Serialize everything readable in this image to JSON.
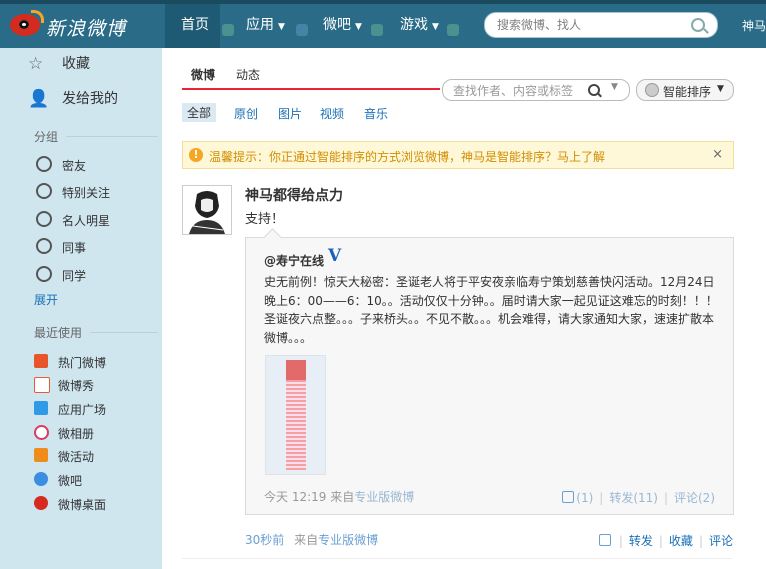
{
  "topbar": {
    "logo_text": "新浪微博",
    "nav": [
      {
        "label": "首页"
      },
      {
        "label": "应用"
      },
      {
        "label": "微吧"
      },
      {
        "label": "游戏"
      }
    ],
    "search_placeholder": "搜索微博、找人",
    "username": "神马"
  },
  "sidebar": {
    "favorites": "收藏",
    "sent_to_me": "发给我的",
    "groups_heading": "分组",
    "groups": [
      "密友",
      "特别关注",
      "名人明星",
      "同事",
      "同学"
    ],
    "expand": "展开",
    "recent_heading": "最近使用",
    "apps": [
      {
        "label": "热门微博",
        "icon": "hot-icon",
        "color": "#e8542b"
      },
      {
        "label": "微博秀",
        "icon": "show-icon",
        "color": "#e45b3a"
      },
      {
        "label": "应用广场",
        "icon": "app-square-icon",
        "color": "#2f9be8"
      },
      {
        "label": "微相册",
        "icon": "album-icon",
        "color": "#d93d62"
      },
      {
        "label": "微活动",
        "icon": "event-icon",
        "color": "#f08c1c"
      },
      {
        "label": "微吧",
        "icon": "weiba-icon",
        "color": "#3a8de0"
      },
      {
        "label": "微博桌面",
        "icon": "desktop-icon",
        "color": "#d52b1e"
      }
    ]
  },
  "main": {
    "tabs": [
      "微博",
      "动态"
    ],
    "filter_placeholder": "查找作者、内容或标签",
    "sort_label": "智能排序",
    "subtabs": [
      "全部",
      "原创",
      "图片",
      "视频",
      "音乐"
    ],
    "notice": "温馨提示：你正通过智能排序的方式浏览微博，神马是智能排序？马上了解",
    "post": {
      "author": "神马都得给点力",
      "text": "支持！",
      "repost": {
        "user": "@寿宁在线",
        "verified_mark": "V",
        "text": "史无前例！惊天大秘密：圣诞老人将于平安夜亲临寿宁策划慈善快闪活动。12月24日晚上6：00——6：10。。活动仅仅十分钟。。届时请大家一起见证这难忘的时刻！！！圣诞夜六点整。。。子来桥头。。不见不散。。。机会难得，请大家通知大家，速速扩散本微博。。。",
        "time": "今天 12:19",
        "from": "来自",
        "source": "专业版微博",
        "like": "(1)",
        "forward": "转发(11)",
        "comment": "评论(2)"
      },
      "time": "30秒前",
      "from": "来自",
      "source": "专业版微博",
      "actions": {
        "forward": "转发",
        "favorite": "收藏",
        "comment": "评论"
      }
    }
  }
}
